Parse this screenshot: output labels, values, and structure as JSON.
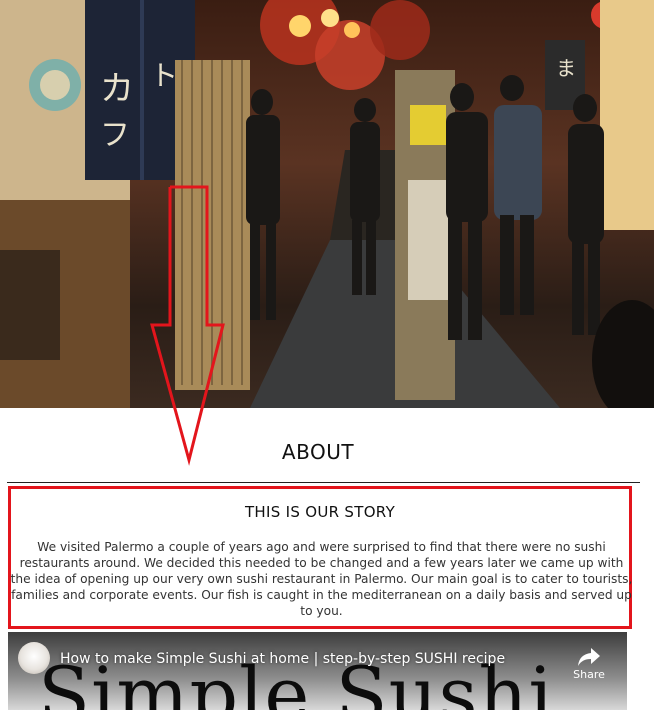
{
  "hero": {
    "image": "night-alley-izakaya-photo"
  },
  "about": {
    "heading": "ABOUT",
    "story_title": "THIS IS OUR STORY",
    "story_text": "We visited Palermo a couple of years ago and were surprised to find that there were no sushi restaurants around. We decided this needed to be changed and a few years later we came up with the idea of opening up our very own sushi restaurant in Palermo. Our main goal is to cater to tourists, families and corporate events. Our fish is caught in the mediterranean on a daily basis and served up to you."
  },
  "video": {
    "title": "How to make Simple Sushi at home | step-by-step SUSHI recipe",
    "thumbnail_text": "Simple Sushi",
    "share_label": "Share"
  },
  "annotation": {
    "color": "#e3151c"
  }
}
